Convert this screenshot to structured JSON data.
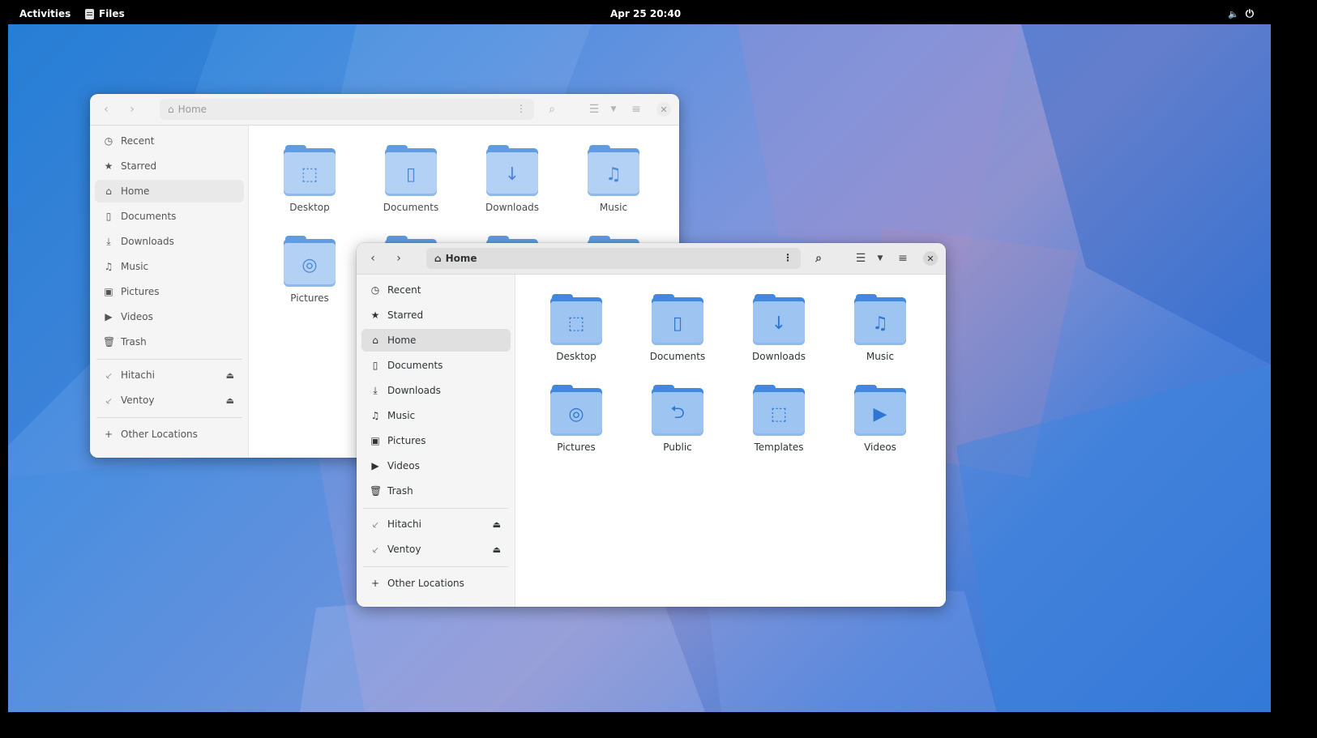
{
  "topbar": {
    "activities": "Activities",
    "app_name": "Files",
    "clock": "Apr 25 20:40"
  },
  "icons": {
    "back": "go-back-icon",
    "forward": "go-forward-icon",
    "home": "home-icon",
    "kebab": "more-options-icon",
    "search": "search-icon",
    "view": "list-view-icon",
    "view_menu": "chevron-down-icon",
    "menu": "hamburger-menu-icon",
    "close": "close-icon",
    "volume": "volume-icon",
    "power": "power-icon"
  },
  "back_window": {
    "path": "Home",
    "sidebar": {
      "places": [
        "Recent",
        "Starred",
        "Home",
        "Documents",
        "Downloads",
        "Music",
        "Pictures",
        "Videos",
        "Trash"
      ],
      "devices": [
        "Hitachi",
        "Ventoy"
      ],
      "other": "Other Locations"
    },
    "files": [
      "Desktop",
      "Documents",
      "Downloads",
      "Music",
      "Pictures"
    ]
  },
  "front_window": {
    "path": "Home",
    "sidebar": {
      "places": [
        "Recent",
        "Starred",
        "Home",
        "Documents",
        "Downloads",
        "Music",
        "Pictures",
        "Videos",
        "Trash"
      ],
      "devices": [
        "Hitachi",
        "Ventoy"
      ],
      "other": "Other Locations"
    },
    "files": [
      "Desktop",
      "Documents",
      "Downloads",
      "Music",
      "Pictures",
      "Public",
      "Templates",
      "Videos"
    ]
  },
  "colors": {
    "folder_dark": "#3f8ae0",
    "folder_light": "#9ec5f2",
    "topbar": "#000000"
  }
}
